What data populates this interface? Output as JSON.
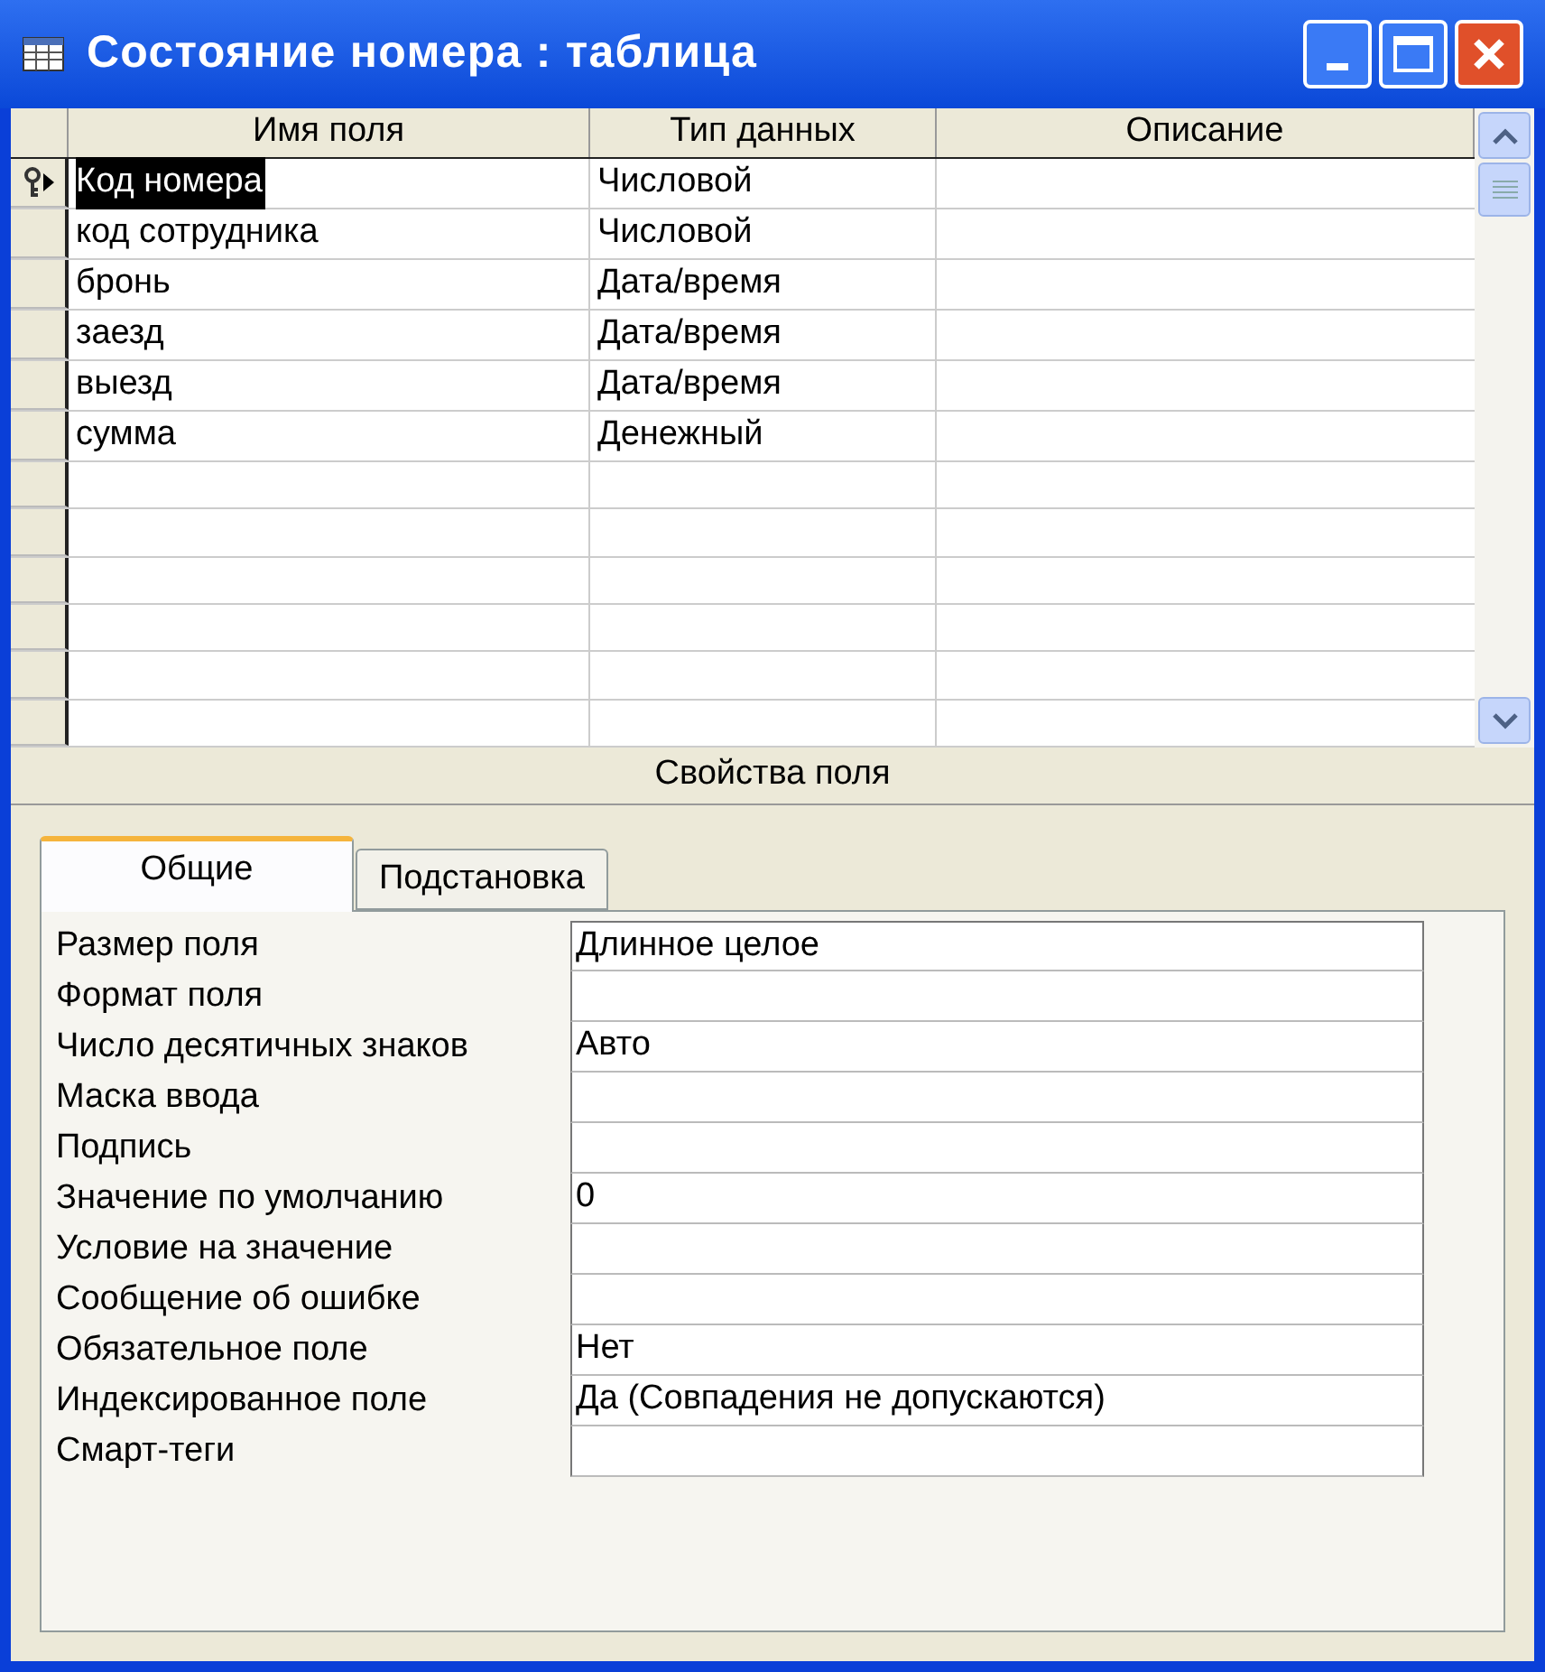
{
  "window": {
    "title": "Состояние номера : таблица"
  },
  "table": {
    "columns": [
      "Имя поля",
      "Тип данных",
      "Описание"
    ],
    "rows": [
      {
        "name": "Код номера",
        "type": "Числовой",
        "selected": true,
        "primary_key": true
      },
      {
        "name": "код сотрудника",
        "type": "Числовой",
        "selected": false,
        "primary_key": false
      },
      {
        "name": "бронь",
        "type": "Дата/время",
        "selected": false,
        "primary_key": false
      },
      {
        "name": "заезд",
        "type": "Дата/время",
        "selected": false,
        "primary_key": false
      },
      {
        "name": "выезд",
        "type": "Дата/время",
        "selected": false,
        "primary_key": false
      },
      {
        "name": "сумма",
        "type": "Денежный",
        "selected": false,
        "primary_key": false
      }
    ]
  },
  "properties_title": "Свойства поля",
  "tabs": [
    {
      "label": "Общие",
      "selected": true
    },
    {
      "label": "Подстановка",
      "selected": false
    }
  ],
  "properties": [
    {
      "label": "Размер поля",
      "value": "Длинное целое"
    },
    {
      "label": "Формат поля"
    },
    {
      "label": "Число десятичных знаков",
      "value": "Авто"
    },
    {
      "label": "Маска ввода"
    },
    {
      "label": "Подпись"
    },
    {
      "label": "Значение по умолчанию",
      "value": "0"
    },
    {
      "label": "Условие на значение"
    },
    {
      "label": "Сообщение об ошибке"
    },
    {
      "label": "Обязательное поле",
      "value": "Нет"
    },
    {
      "label": "Индексированное поле",
      "value": "Да (Совпадения не допускаются)"
    },
    {
      "label": "Смарт-теги"
    }
  ]
}
